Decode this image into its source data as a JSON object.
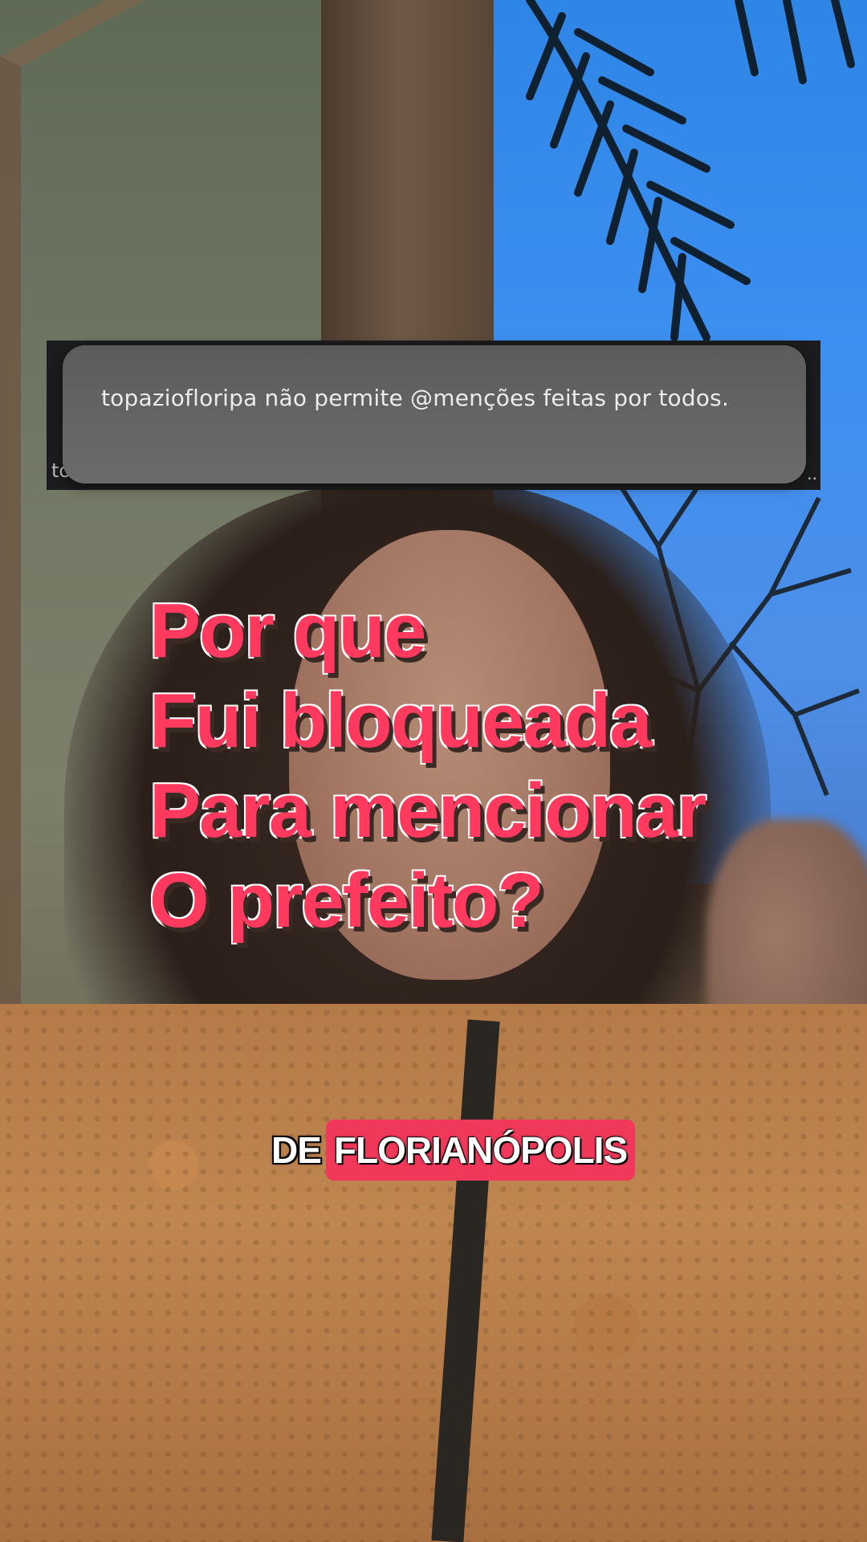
{
  "notification": {
    "message": "topaziofloripa não permite @menções feitas por todos.",
    "partial_text_behind": "to",
    "ellipsis": "..",
    "band_color": "#1c1c1e",
    "toast_color": "#636363"
  },
  "caption": {
    "lines": [
      "Por que",
      "Fui bloqueada",
      "Para mencionar",
      "O prefeito?"
    ],
    "color": "#ff3a5e"
  },
  "subtitle": {
    "plain": "DE",
    "highlighted": "FLORIANÓPOLIS",
    "highlight_color": "#f0385a"
  }
}
